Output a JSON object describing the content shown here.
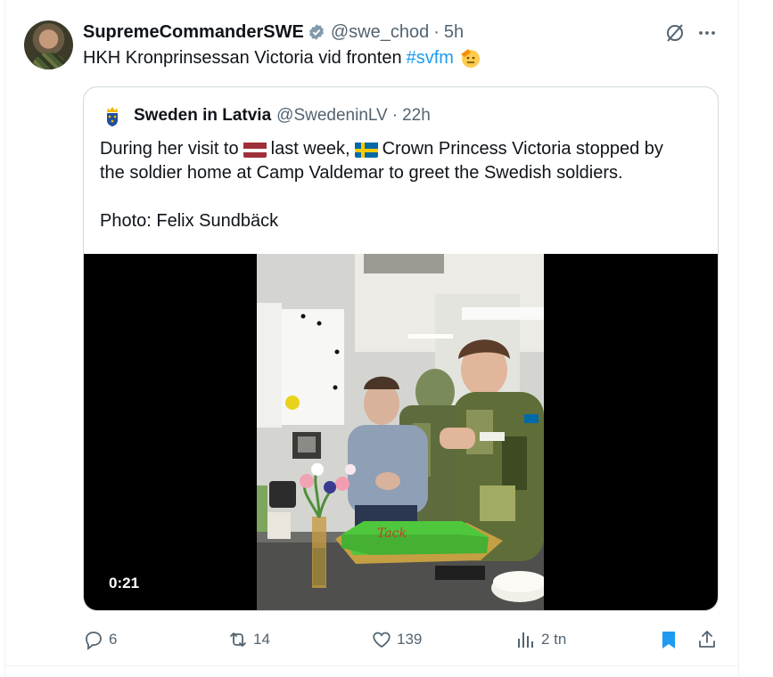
{
  "tweet": {
    "display_name": "SupremeCommanderSWE",
    "handle": "@swe_chod",
    "separator": "·",
    "time": "5h",
    "text": "HKH Kronprinsessan Victoria vid fronten",
    "hashtag": "#svfm",
    "avatar_icon": "avatar-photo",
    "verified_icon": "verified-badge-icon",
    "menu_icons": [
      "grok-icon",
      "more-icon"
    ]
  },
  "quoted_tweet": {
    "display_name": "Sweden in Latvia",
    "handle": "@SwedeninLV",
    "separator": "·",
    "time": "22h",
    "text_part1": "During her visit to",
    "text_part2": "last week,",
    "text_part3": "Crown Princess Victoria stopped by",
    "text_line2": "the soldier home at Camp Valdemar to greet the Swedish soldiers.",
    "photo_credit": "Photo: Felix Sundbäck",
    "flags": [
      "latvia-flag-icon",
      "sweden-flag-icon"
    ],
    "video": {
      "duration": "0:21"
    }
  },
  "actions": {
    "replies": "6",
    "retweets": "14",
    "likes": "139",
    "views": "2 tn",
    "icons": [
      "reply-icon",
      "retweet-icon",
      "like-icon",
      "views-icon",
      "bookmark-icon",
      "share-icon"
    ]
  },
  "colors": {
    "accent": "#1d9bf0",
    "muted_text": "#536471",
    "border": "#cfd9de",
    "verified": "#829aab"
  }
}
